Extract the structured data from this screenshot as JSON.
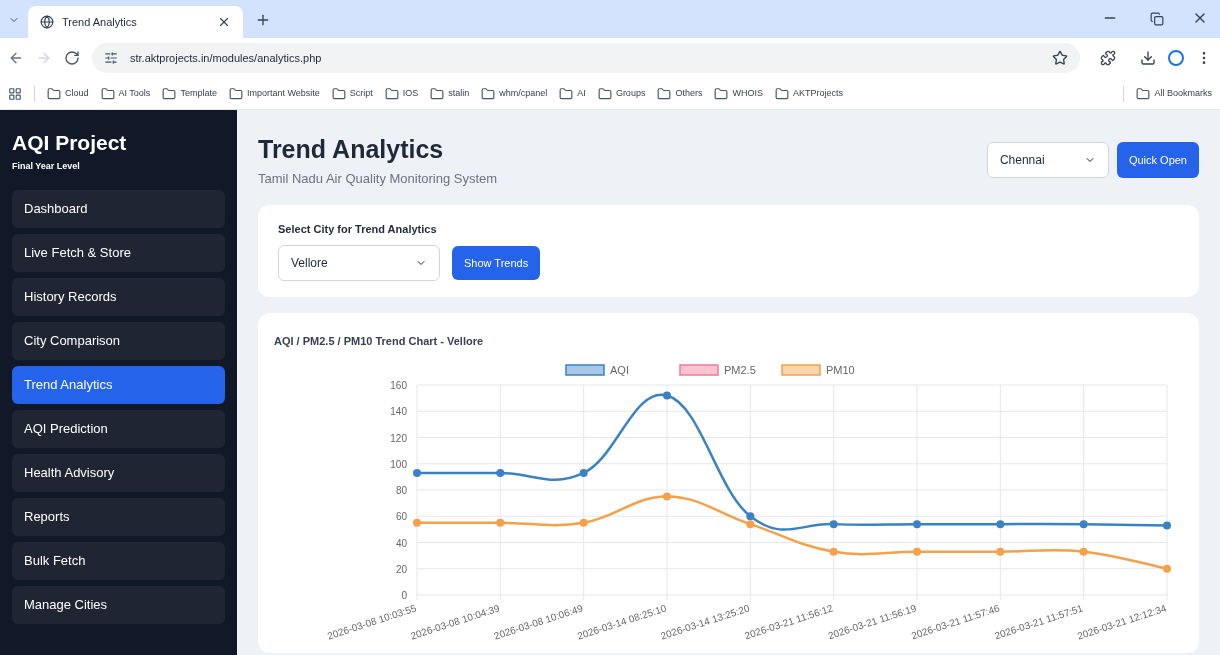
{
  "browser": {
    "tabs": [
      {
        "title": "Trend Analytics",
        "selected": true
      }
    ],
    "url": "str.aktprojects.in/modules/analytics.php",
    "bookmarks": [
      "Cloud",
      "AI Tools",
      "Template",
      "Important Website",
      "Script",
      "IOS",
      "stalin",
      "whm/cpanel",
      "AI",
      "Groups",
      "Others",
      "WHOIS",
      "AKTProjects"
    ],
    "all_bookmarks": "All Bookmarks"
  },
  "sidebar": {
    "title": "AQI Project",
    "subtitle": "Final Year Level",
    "items": [
      {
        "label": "Dashboard",
        "selected": false
      },
      {
        "label": "Live Fetch & Store",
        "selected": false
      },
      {
        "label": "History Records",
        "selected": false
      },
      {
        "label": "City Comparison",
        "selected": false
      },
      {
        "label": "Trend Analytics",
        "selected": true
      },
      {
        "label": "AQI Prediction",
        "selected": false
      },
      {
        "label": "Health Advisory",
        "selected": false
      },
      {
        "label": "Reports",
        "selected": false
      },
      {
        "label": "Bulk Fetch",
        "selected": false
      },
      {
        "label": "Manage Cities",
        "selected": false
      }
    ]
  },
  "header": {
    "title": "Trend Analytics",
    "subtitle": "Tamil Nadu Air Quality Monitoring System",
    "city_select": "Chennai",
    "quick_open": "Quick Open"
  },
  "selector": {
    "label": "Select City for Trend Analytics",
    "city_select": "Vellore",
    "button": "Show Trends"
  },
  "chart_card": {
    "title": "AQI / PM2.5 / PM10 Trend Chart - Vellore",
    "chart_data": {
      "type": "line",
      "grid": true,
      "legend": true,
      "categories": [
        "2026-03-08 10:03:55",
        "2026-03-08 10:04:39",
        "2026-03-08 10:06:49",
        "2026-03-14 08:25:10",
        "2026-03-14 13:25:20",
        "2026-03-21 11:56:12",
        "2026-03-21 11:56:19",
        "2026-03-21 11:57:46",
        "2026-03-21 11:57:51",
        "2026-03-21 12:12:34"
      ],
      "series": [
        {
          "name": "AQI",
          "color": "#3b82c4",
          "marker": true,
          "values": [
            93,
            93,
            93,
            152,
            60,
            54,
            54,
            54,
            54,
            53
          ]
        },
        {
          "name": "PM2.5",
          "color": "#f47a96",
          "values": [
            null,
            null,
            null,
            null,
            null,
            null,
            null,
            null,
            null,
            null
          ]
        },
        {
          "name": "PM10",
          "color": "#f5a04a",
          "marker": true,
          "values": [
            55,
            55,
            55,
            75,
            54,
            33,
            33,
            33,
            33,
            20
          ]
        }
      ],
      "ylim": [
        0,
        160
      ],
      "yticks": [
        0,
        20,
        40,
        60,
        80,
        100,
        120,
        140,
        160
      ]
    }
  }
}
